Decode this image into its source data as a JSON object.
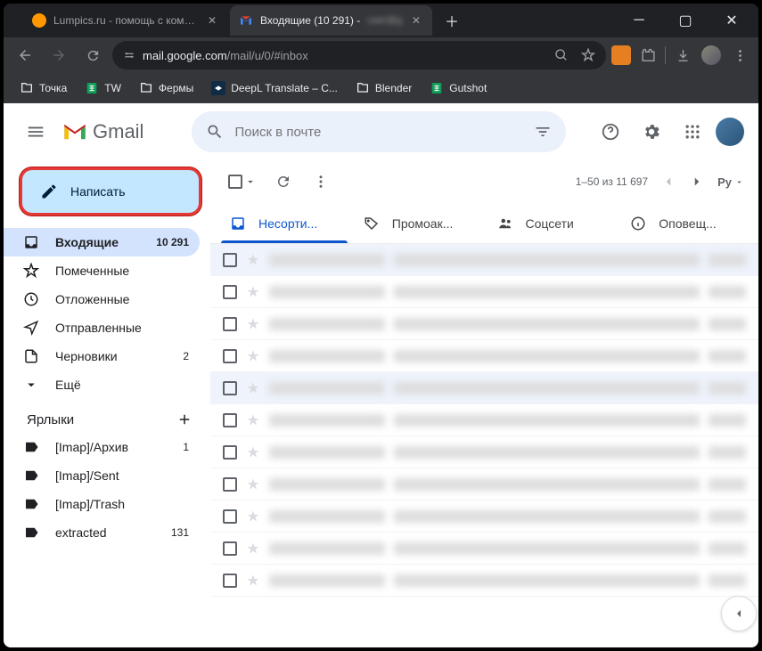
{
  "browser": {
    "tabs": [
      {
        "title": "Lumpics.ru - помощь с компью",
        "active": false
      },
      {
        "title": "Входящие (10 291) - ",
        "active": true
      }
    ],
    "url_host": "mail.google.com",
    "url_path": "/mail/u/0/#inbox"
  },
  "bookmarks": [
    {
      "label": "Точка",
      "icon": "folder"
    },
    {
      "label": "TW",
      "icon": "sheet"
    },
    {
      "label": "Фермы",
      "icon": "folder"
    },
    {
      "label": "DeepL Translate – C...",
      "icon": "deepl"
    },
    {
      "label": "Blender",
      "icon": "folder"
    },
    {
      "label": "Gutshot",
      "icon": "sheet"
    }
  ],
  "gmail": {
    "brand": "Gmail",
    "search_placeholder": "Поиск в почте",
    "compose": "Написать",
    "nav": [
      {
        "icon": "inbox",
        "label": "Входящие",
        "count": "10 291",
        "active": true
      },
      {
        "icon": "star",
        "label": "Помеченные"
      },
      {
        "icon": "clock",
        "label": "Отложенные"
      },
      {
        "icon": "send",
        "label": "Отправленные"
      },
      {
        "icon": "draft",
        "label": "Черновики",
        "count": "2"
      },
      {
        "icon": "more",
        "label": "Ещё"
      }
    ],
    "labels_header": "Ярлыки",
    "labels": [
      {
        "label": "[Imap]/Архив",
        "count": "1"
      },
      {
        "label": "[Imap]/Sent"
      },
      {
        "label": "[Imap]/Trash"
      },
      {
        "label": "extracted",
        "count": "131"
      }
    ],
    "pager": "1–50 из 11 697",
    "lang_btn": "Рy",
    "tabs": [
      {
        "label": "Несорти...",
        "icon": "inbox",
        "active": true
      },
      {
        "label": "Промоак...",
        "icon": "tag"
      },
      {
        "label": "Соцсети",
        "icon": "people"
      },
      {
        "label": "Оповещ...",
        "icon": "info"
      }
    ]
  }
}
